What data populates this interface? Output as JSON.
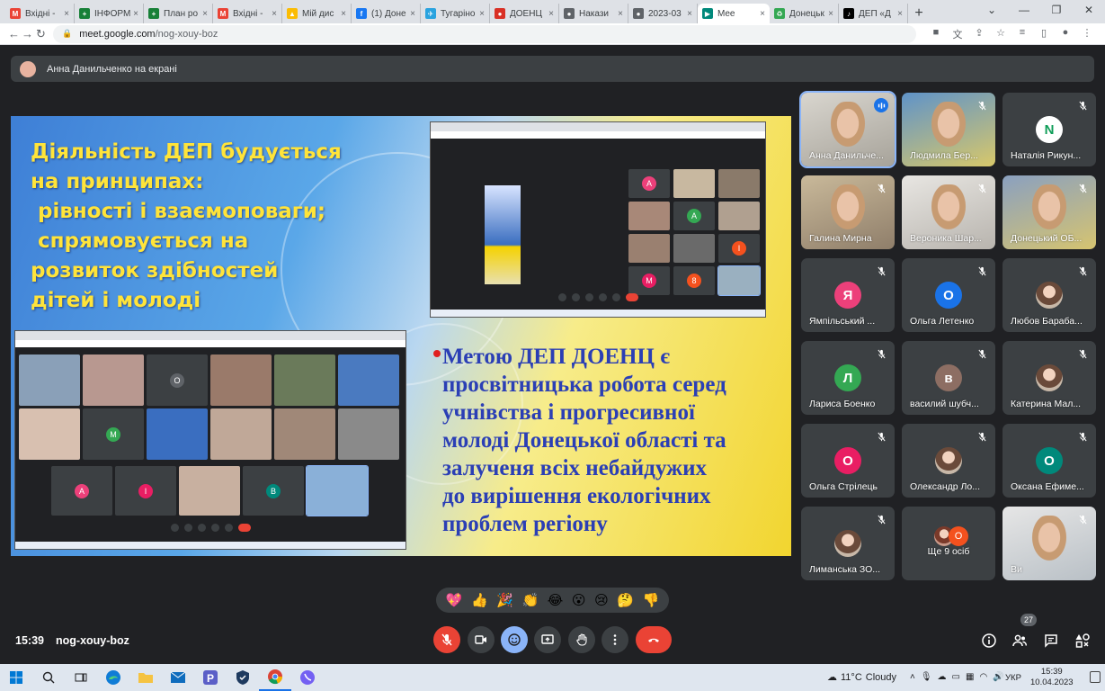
{
  "browser": {
    "tabs": [
      {
        "title": "Вхідні -",
        "color": "#ea4335",
        "glyph": "M"
      },
      {
        "title": "ІНФОРМ",
        "color": "#188038",
        "glyph": "+"
      },
      {
        "title": "План ро",
        "color": "#188038",
        "glyph": "+"
      },
      {
        "title": "Вхідні -",
        "color": "#ea4335",
        "glyph": "M"
      },
      {
        "title": "Мій дис",
        "color": "#fbbc04",
        "glyph": "▲"
      },
      {
        "title": "(1) Доне",
        "color": "#1877f2",
        "glyph": "f"
      },
      {
        "title": "Тугаріно",
        "color": "#2aa3df",
        "glyph": "✈"
      },
      {
        "title": "ДОЕНЦ",
        "color": "#d93025",
        "glyph": "●"
      },
      {
        "title": "Накази",
        "color": "#5f6368",
        "glyph": "●"
      },
      {
        "title": "2023-03",
        "color": "#5f6368",
        "glyph": "●"
      },
      {
        "title": "Mee",
        "color": "#00897b",
        "glyph": "▶",
        "active": true
      },
      {
        "title": "Донецьк",
        "color": "#34a853",
        "glyph": "♻"
      },
      {
        "title": "ДЕП «Д",
        "color": "#000000",
        "glyph": "♪"
      }
    ],
    "new_tab": "+",
    "url_host": "meet.google.com",
    "url_path": "/nog-xouy-boz"
  },
  "meet": {
    "presenting_label": "Анна Данильченко на екрані",
    "slide": {
      "left_lines": [
        "Діяльність ДЕП будується",
        "на принципах:",
        " рівності і взаємоповаги;",
        " спрямовується на",
        "розвиток здібностей",
        "дітей і молоді"
      ],
      "right_lines": [
        "Метою ДЕП ДОЕНЦ є",
        "просвітницька робота серед",
        "учнівства і прогресивної",
        "молоді Донецької області та",
        "залученя всіх небайдужих",
        "до вирішення екологічних",
        "проблем регіону"
      ]
    },
    "participants": [
      {
        "name": "Анна Данильче...",
        "kind": "video",
        "speaking": true
      },
      {
        "name": "Людмила Бер...",
        "kind": "video"
      },
      {
        "name": "Наталія Рикун...",
        "kind": "avatar",
        "letter": "N",
        "color": "#ffffff",
        "textcolor": "#0f9d58"
      },
      {
        "name": "Галина Мирна",
        "kind": "video"
      },
      {
        "name": "Вероника Шар...",
        "kind": "video"
      },
      {
        "name": "Донецький ОБ...",
        "kind": "video"
      },
      {
        "name": "Ямпільський ...",
        "kind": "avatar",
        "letter": "Я",
        "color": "#ec407a"
      },
      {
        "name": "Ольга Летенко",
        "kind": "avatar",
        "letter": "О",
        "color": "#1a73e8"
      },
      {
        "name": "Любов Бараба...",
        "kind": "photo"
      },
      {
        "name": "Лариса Боенко",
        "kind": "avatar",
        "letter": "Л",
        "color": "#34a853"
      },
      {
        "name": "василий шубч...",
        "kind": "avatar",
        "letter": "в",
        "color": "#8d6e63"
      },
      {
        "name": "Катерина Мал...",
        "kind": "photo"
      },
      {
        "name": "Ольга Стрілець",
        "kind": "avatar",
        "letter": "О",
        "color": "#e91e63"
      },
      {
        "name": "Олександр Ло...",
        "kind": "photo"
      },
      {
        "name": "Оксана Ефиме...",
        "kind": "avatar",
        "letter": "О",
        "color": "#00897b"
      },
      {
        "name": "Лиманська ЗО...",
        "kind": "photo"
      },
      {
        "name": "Ще 9 осіб",
        "kind": "more",
        "letter": "О"
      },
      {
        "name": "Ви",
        "kind": "video"
      }
    ],
    "reactions": [
      "💖",
      "👍",
      "🎉",
      "👏",
      "😂",
      "😮",
      "😢",
      "🤔",
      "👎"
    ],
    "clock": "15:39",
    "meeting_code": "nog-xouy-boz",
    "people_count": "27"
  },
  "taskbar": {
    "temperature": "11°C",
    "weather": "Cloudy",
    "lang": "УКР",
    "time": "15:39",
    "date": "10.04.2023"
  }
}
